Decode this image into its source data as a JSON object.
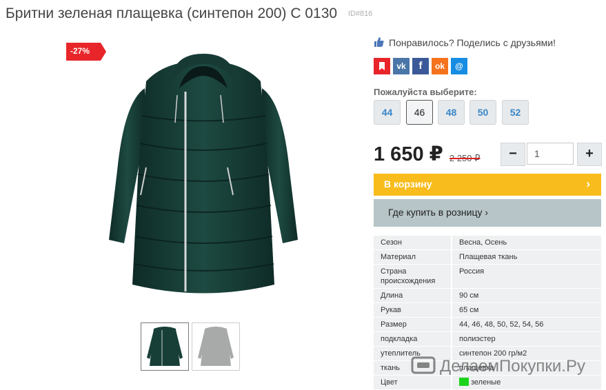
{
  "product": {
    "title": "Бритни зеленая плащевка (синтепон 200) С 0130",
    "id_label": "ID#816"
  },
  "gallery": {
    "discount_badge": "-27%"
  },
  "share": {
    "text": "Понравилось? Поделись с друзьями!",
    "networks": [
      {
        "name": "bookmark-icon",
        "glyph": "",
        "color": "#e8262a"
      },
      {
        "name": "vk-icon",
        "glyph": "vk",
        "color": "#4a76a8"
      },
      {
        "name": "facebook-icon",
        "glyph": "f",
        "color": "#3b5998"
      },
      {
        "name": "odnoklassniki-icon",
        "glyph": "ok",
        "color": "#f4731c"
      },
      {
        "name": "moimir-icon",
        "glyph": "@",
        "color": "#168de2"
      }
    ]
  },
  "size_selector": {
    "label": "Пожалуйста выберите:",
    "options": [
      "44",
      "46",
      "48",
      "50",
      "52"
    ],
    "selected": "46"
  },
  "pricing": {
    "price": "1 650 ₽",
    "old_price": "2 250 ₽"
  },
  "quantity": {
    "value": "1",
    "minus": "−",
    "plus": "+"
  },
  "buttons": {
    "cart": "В корзину",
    "cart_chevron": "›",
    "retail": "Где купить в розницу ›"
  },
  "specs": [
    {
      "key": "Сезон",
      "value": "Весна, Осень"
    },
    {
      "key": "Материал",
      "value": "Плащевая ткань"
    },
    {
      "key": "Страна происхождения",
      "value": "Россия"
    },
    {
      "key": "Длина",
      "value": "90 см"
    },
    {
      "key": "Рукав",
      "value": "65 см"
    },
    {
      "key": "Размер",
      "value": "44, 46, 48, 50, 52, 54, 56"
    },
    {
      "key": "подкладка",
      "value": "полиэстер"
    },
    {
      "key": "утеплитель",
      "value": "синтепон 200 гр/м2"
    },
    {
      "key": "ткань",
      "value": "плащевка"
    },
    {
      "key": "Цвет",
      "value": "зеленые",
      "swatch": "#1dd41d"
    }
  ],
  "watermark": {
    "text": "ДелаемПокупки.Ру"
  },
  "colors": {
    "cart": "#f8bc1c",
    "retail": "#b7c5c8",
    "discount": "#e8262a",
    "link": "#3a86c8"
  }
}
